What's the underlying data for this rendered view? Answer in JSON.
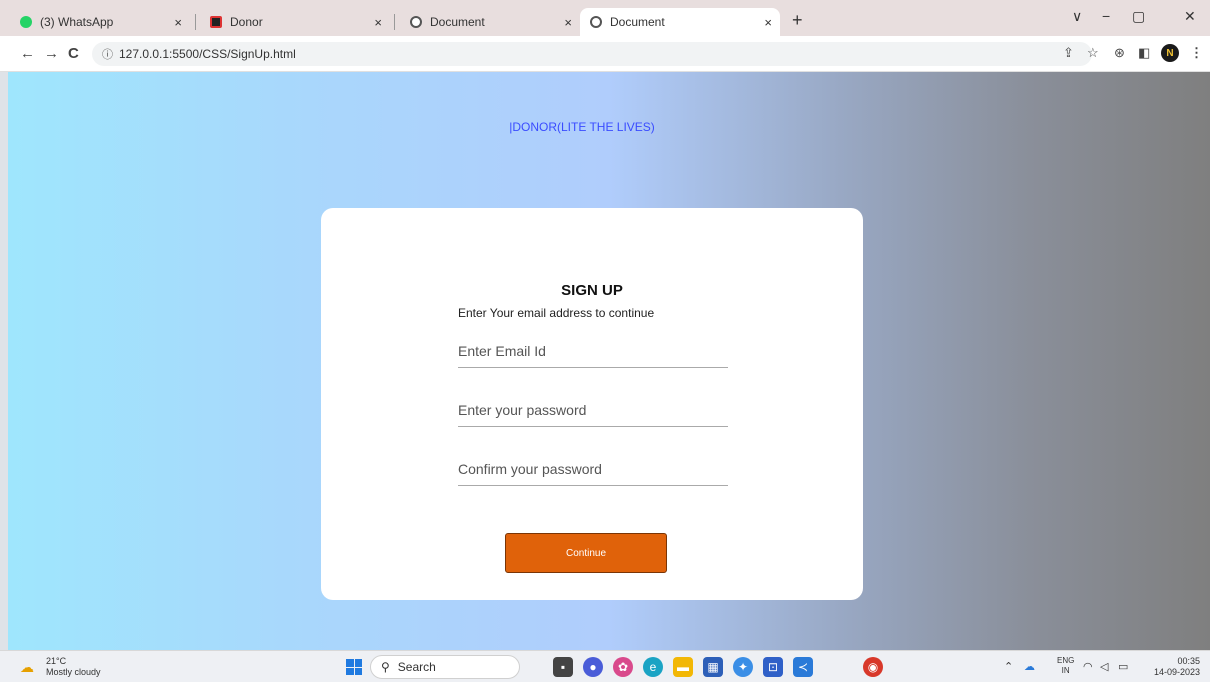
{
  "browser": {
    "tabs": [
      {
        "title": "(3) WhatsApp",
        "favicon_color": "#25d366"
      },
      {
        "title": "Donor",
        "favicon_color": "#222222"
      },
      {
        "title": "Document",
        "favicon_color": "#555555"
      },
      {
        "title": "Document",
        "favicon_color": "#555555"
      }
    ],
    "close_glyph": "×",
    "new_tab_glyph": "+",
    "url": "127.0.0.1:5500/CSS/SignUp.html",
    "profile_initial": "N",
    "window_controls": [
      "∨",
      "−",
      "▢",
      "✕"
    ]
  },
  "page": {
    "brand": "|DONOR(LITE THE LIVES)",
    "title": "SIGN UP",
    "subtitle": "Enter Your email address to continue",
    "email_placeholder": "Enter Email Id",
    "password_placeholder": "Enter your password",
    "confirm_placeholder": "Confirm your password",
    "continue_label": "Continue",
    "accent_color": "#e0620a",
    "brand_color": "#3a4cff"
  },
  "taskbar": {
    "temperature": "21°C",
    "weather": "Mostly cloudy",
    "search_label": "Search",
    "lang_top": "ENG",
    "lang_bottom": "IN",
    "time": "00:35",
    "date": "14-09-2023",
    "apps": [
      "file-explorer-icon",
      "meet-icon",
      "photos-icon",
      "edge-icon",
      "folder-icon",
      "store-icon",
      "copilot-icon",
      "gamebar-icon",
      "vscode-icon",
      "chrome-icon"
    ]
  }
}
